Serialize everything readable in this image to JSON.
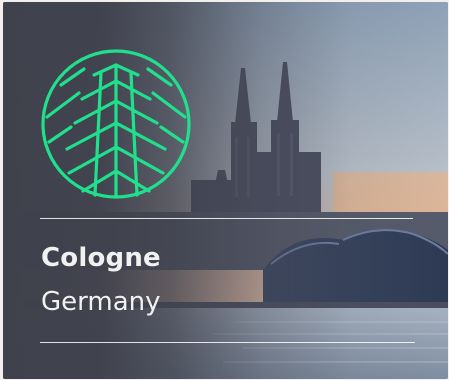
{
  "destination": {
    "city": "Cologne",
    "country": "Germany",
    "logo_icon": "cologne-cathedral-badge-icon",
    "accent_color": "#20e08d"
  }
}
